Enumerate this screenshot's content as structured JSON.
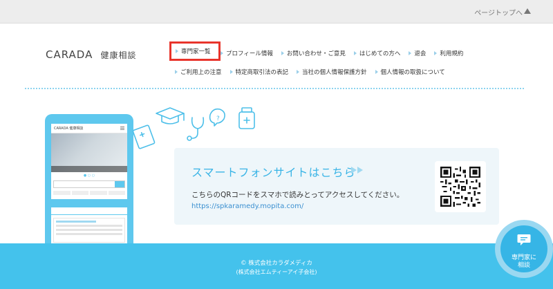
{
  "pagetop": {
    "label": "ページトップへ"
  },
  "logo": {
    "main": "CARADA",
    "sub": "健康相談"
  },
  "nav": {
    "row1": [
      "専門家一覧",
      "プロフィール情報",
      "お問い合わせ・ご意見",
      "はじめての方へ",
      "退会",
      "利用規約"
    ],
    "row2": [
      "ご利用上の注意",
      "特定商取引法の表記",
      "当社の個人情報保護方針",
      "個人情報の取扱について"
    ]
  },
  "phone_screen": {
    "logo": "CARADA 健康相談"
  },
  "qr": {
    "title": "スマートフォンサイトはこちら",
    "arrows": "▶▶",
    "description": "こちらのQRコードをスマホで読みとってアクセスしてください。",
    "url": "https://spkaramedy.mopita.com/"
  },
  "footer": {
    "copyright": "© 株式会社カラダメディカ",
    "subsidiary": "(株式会社エムティーアイ子会社)"
  },
  "consult_button": {
    "line1": "専門家に",
    "line2": "相談"
  },
  "colors": {
    "accent": "#39b4e6",
    "footer": "#44c2ec",
    "highlight": "#e8342b"
  }
}
